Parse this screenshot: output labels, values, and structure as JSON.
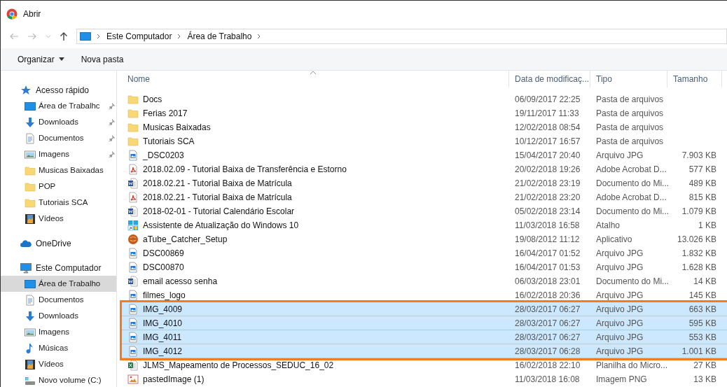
{
  "window": {
    "title": "Abrir"
  },
  "address_bar": {
    "path": [
      "Este Computador",
      "Área de Trabalho"
    ]
  },
  "toolbar": {
    "buttons": [
      {
        "label": "Organizar",
        "dropdown": true
      },
      {
        "label": "Nova pasta",
        "dropdown": false
      }
    ]
  },
  "sidebar": {
    "groups": [
      {
        "label": "Acesso rápido",
        "kind": "star",
        "children": [
          {
            "label": "Área de Trabalhc",
            "kind": "desktop",
            "pinned": true,
            "selected": false
          },
          {
            "label": "Downloads",
            "kind": "download",
            "pinned": true,
            "selected": false
          },
          {
            "label": "Documentos",
            "kind": "document",
            "pinned": true,
            "selected": false
          },
          {
            "label": "Imagens",
            "kind": "images",
            "pinned": true,
            "selected": false
          },
          {
            "label": "Musicas Baixadas",
            "kind": "folder",
            "pinned": false,
            "selected": false
          },
          {
            "label": "POP",
            "kind": "folder",
            "pinned": false,
            "selected": false
          },
          {
            "label": "Tutoriais SCA",
            "kind": "folder",
            "pinned": false,
            "selected": false
          },
          {
            "label": "Vídeos",
            "kind": "video",
            "pinned": false,
            "selected": false
          }
        ]
      },
      {
        "label": "OneDrive",
        "kind": "cloud"
      },
      {
        "label": "Este Computador",
        "kind": "computer",
        "children": [
          {
            "label": "Área de Trabalho",
            "kind": "desktop",
            "pinned": false,
            "selected": true
          },
          {
            "label": "Documentos",
            "kind": "document",
            "pinned": false,
            "selected": false
          },
          {
            "label": "Downloads",
            "kind": "download",
            "pinned": false,
            "selected": false
          },
          {
            "label": "Imagens",
            "kind": "images",
            "pinned": false,
            "selected": false
          },
          {
            "label": "Músicas",
            "kind": "music",
            "pinned": false,
            "selected": false
          },
          {
            "label": "Vídeos",
            "kind": "video",
            "pinned": false,
            "selected": false
          },
          {
            "label": "Novo volume (C:)",
            "kind": "drive",
            "pinned": false,
            "selected": false
          }
        ]
      }
    ]
  },
  "table": {
    "columns": [
      "Nome",
      "Data de modificaç...",
      "Tipo",
      "Tamanho"
    ],
    "rows": [
      {
        "kind": "folder",
        "name": "Docs",
        "date": "06/09/2017 22:25",
        "type": "Pasta de arquivos",
        "selected": false,
        "outlined": false
      },
      {
        "kind": "folder",
        "name": "Ferias 2017",
        "date": "19/11/2017 11:33",
        "type": "Pasta de arquivos",
        "selected": false,
        "outlined": false
      },
      {
        "kind": "folder",
        "name": "Musicas Baixadas",
        "date": "12/02/2018 08:54",
        "type": "Pasta de arquivos",
        "selected": false,
        "outlined": false
      },
      {
        "kind": "folder",
        "name": "Tutoriais SCA",
        "date": "10/12/2017 16:57",
        "type": "Pasta de arquivos",
        "selected": false,
        "outlined": false
      },
      {
        "kind": "image",
        "name": "_DSC0203",
        "date": "15/04/2017 20:40",
        "type": "Arquivo JPG",
        "size": "7.903 KB",
        "selected": false,
        "outlined": false
      },
      {
        "kind": "pdf",
        "name": "2018.02.09 - Tutorial Baixa de Transferência e Estorno",
        "date": "20/02/2018 19:26",
        "type": "Adobe Acrobat D...",
        "size": "577 KB",
        "selected": false,
        "outlined": false
      },
      {
        "kind": "word",
        "name": "2018.02.21 - Tutorial Baixa de Matrícula",
        "date": "21/02/2018 23:19",
        "type": "Documento do Mi...",
        "size": "489 KB",
        "selected": false,
        "outlined": false
      },
      {
        "kind": "pdf",
        "name": "2018.02.21 - Tutorial Baixa de Matrícula",
        "date": "21/02/2018 23:20",
        "type": "Adobe Acrobat D...",
        "size": "815 KB",
        "selected": false,
        "outlined": false
      },
      {
        "kind": "word",
        "name": "2018-02-01 - Tutorial Calendário Escolar",
        "date": "05/02/2018 23:14",
        "type": "Documento do Mi...",
        "size": "1.079 KB",
        "selected": false,
        "outlined": false
      },
      {
        "kind": "shortcut",
        "name": "Assistente de Atualização do Windows 10",
        "date": "11/03/2018 16:58",
        "type": "Atalho",
        "size": "1 KB",
        "selected": false,
        "outlined": false
      },
      {
        "kind": "app",
        "name": "aTube_Catcher_Setup",
        "date": "19/08/2012 11:12",
        "type": "Aplicativo",
        "size": "13.026 KB",
        "selected": false,
        "outlined": false
      },
      {
        "kind": "image",
        "name": "DSC00869",
        "date": "16/04/2017 01:52",
        "type": "Arquivo JPG",
        "size": "1.832 KB",
        "selected": false,
        "outlined": false
      },
      {
        "kind": "image",
        "name": "DSC00870",
        "date": "16/04/2017 01:53",
        "type": "Arquivo JPG",
        "size": "1.628 KB",
        "selected": false,
        "outlined": false
      },
      {
        "kind": "word",
        "name": "email acesso senha",
        "date": "06/03/2018 23:01",
        "type": "Documento do Mi...",
        "size": "14 KB",
        "selected": false,
        "outlined": false
      },
      {
        "kind": "image",
        "name": "filmes_logo",
        "date": "16/02/2018 20:36",
        "type": "Arquivo JPG",
        "size": "145 KB",
        "selected": false,
        "outlined": false
      },
      {
        "kind": "image",
        "name": "IMG_4009",
        "date": "28/03/2017 06:27",
        "type": "Arquivo JPG",
        "size": "663 KB",
        "selected": true,
        "outlined": true
      },
      {
        "kind": "image",
        "name": "IMG_4010",
        "date": "28/03/2017 06:27",
        "type": "Arquivo JPG",
        "size": "595 KB",
        "selected": true,
        "outlined": true
      },
      {
        "kind": "image",
        "name": "IMG_4011",
        "date": "28/03/2017 06:27",
        "type": "Arquivo JPG",
        "size": "553 KB",
        "selected": true,
        "outlined": true
      },
      {
        "kind": "image",
        "name": "IMG_4012",
        "date": "28/03/2017 06:28",
        "type": "Arquivo JPG",
        "size": "1.001 KB",
        "selected": true,
        "outlined": true
      },
      {
        "kind": "excel",
        "name": "JLMS_Mapeamento de Processos_SEDUC_16_02",
        "date": "16/02/2018 22:10",
        "type": "Planilha do Micro...",
        "size": "27 KB",
        "selected": false,
        "outlined": false
      },
      {
        "kind": "png",
        "name": "pastedImage (1)",
        "date": "11/03/2018 16:08",
        "type": "Imagem PNG",
        "size": "13 KB",
        "selected": false,
        "outlined": false
      }
    ]
  }
}
